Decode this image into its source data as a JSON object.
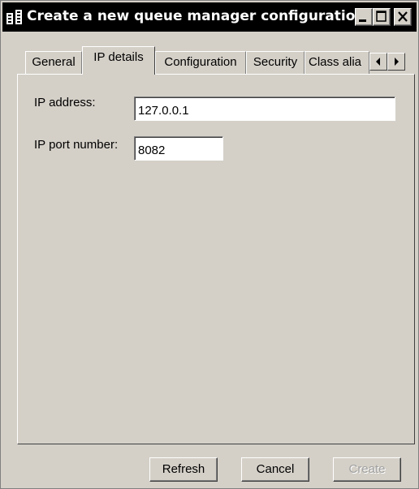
{
  "window": {
    "title": "Create a new queue manager configuration",
    "icon": "queue-manager-icon",
    "controls": {
      "minimize": "minimize-icon",
      "maximize": "maximize-icon",
      "close": "close-icon"
    }
  },
  "tabs": [
    {
      "label": "General",
      "active": false
    },
    {
      "label": "IP details",
      "active": true
    },
    {
      "label": "Configuration",
      "active": false
    },
    {
      "label": "Security",
      "active": false
    },
    {
      "label": "Class alia",
      "active": false
    }
  ],
  "tab_scroll": {
    "left": "arrow-left-icon",
    "right": "arrow-right-icon"
  },
  "form": {
    "ip_address_label": "IP address:",
    "ip_address_value": "127.0.0.1",
    "port_label": "IP port number:",
    "port_value": "8082"
  },
  "buttons": {
    "refresh": "Refresh",
    "cancel": "Cancel",
    "create": "Create",
    "create_enabled": false
  }
}
